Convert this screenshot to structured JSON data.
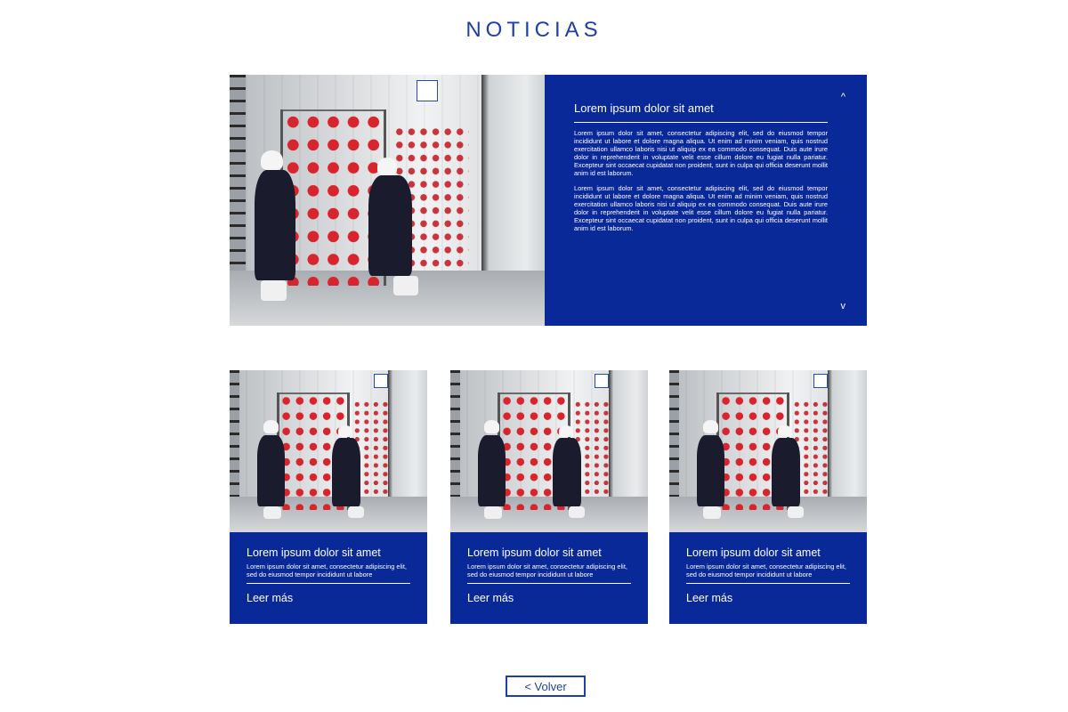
{
  "header": {
    "title": "NOTICIAS"
  },
  "featured": {
    "heading": "Lorem ipsum dolor sit amet",
    "paragraphs": [
      "Lorem ipsum dolor sit amet, consectetur adipiscing elit, sed do eiusmod tempor incididunt ut labore et dolore magna aliqua. Ut enim ad minim veniam, quis nostrud exercitation ullamco laboris nisi ut aliquip ex ea commodo consequat. Duis aute irure dolor in reprehenderit in voluptate velit esse cillum dolore eu fugiat nulla pariatur. Excepteur sint occaecat cupidatat non proident, sunt in culpa qui officia deserunt mollit anim id est laborum.",
      "Lorem ipsum dolor sit amet, consectetur adipiscing elit, sed do eiusmod tempor incididunt ut labore et dolore magna aliqua. Ut enim ad minim veniam, quis nostrud exercitation ullamco laboris nisi ut aliquip ex ea commodo consequat. Duis aute irure dolor in reprehenderit in voluptate velit esse cillum dolore eu fugiat nulla pariatur. Excepteur sint occaecat cupidatat non proident, sunt in culpa qui officia deserunt mollit anim id est laborum."
    ],
    "scroll_up_glyph": "^",
    "scroll_down_glyph": "v"
  },
  "cards": [
    {
      "title": "Lorem ipsum dolor sit amet",
      "text": "Lorem ipsum dolor sit amet, consectetur adipiscing elit, sed do eiusmod tempor incididunt ut labore",
      "link": "Leer más"
    },
    {
      "title": "Lorem ipsum dolor sit amet",
      "text": "Lorem ipsum dolor sit amet, consectetur adipiscing elit, sed do eiusmod tempor incididunt ut labore",
      "link": "Leer más"
    },
    {
      "title": "Lorem ipsum dolor sit amet",
      "text": "Lorem ipsum dolor sit amet, consectetur adipiscing elit, sed do eiusmod tempor incididunt ut labore",
      "link": "Leer más"
    }
  ],
  "back_button": {
    "label": "< Volver"
  },
  "colors": {
    "brand_blue": "#0a2999",
    "title_blue": "#1f3fa8",
    "background": "#ffffff",
    "text_on_blue": "#ffffff"
  }
}
